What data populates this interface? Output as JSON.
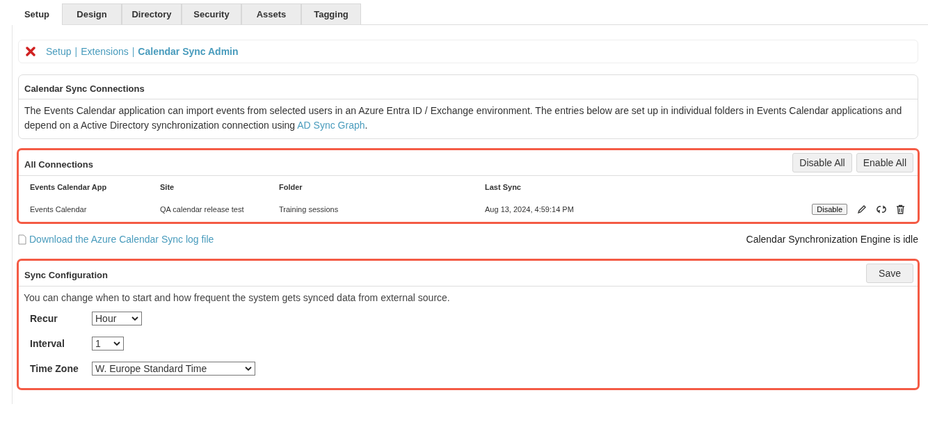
{
  "tabs": [
    {
      "label": "Setup",
      "selected": true
    },
    {
      "label": "Design",
      "selected": false
    },
    {
      "label": "Directory",
      "selected": false
    },
    {
      "label": "Security",
      "selected": false
    },
    {
      "label": "Assets",
      "selected": false
    },
    {
      "label": "Tagging",
      "selected": false
    }
  ],
  "breadcrumb": {
    "separator": "|",
    "items": [
      {
        "label": "Setup",
        "current": false
      },
      {
        "label": "Extensions",
        "current": false
      },
      {
        "label": "Calendar Sync Admin",
        "current": true
      }
    ]
  },
  "intro": {
    "title": "Calendar Sync Connections",
    "text_before": "The Events Calendar application can import events from selected users in an Azure Entra ID / Exchange environment. The entries below are set up in individual folders in Events Calendar applications and depend on a Active Directory synchronization connection using ",
    "link": "AD Sync Graph",
    "text_after": "."
  },
  "connections": {
    "title": "All Connections",
    "highlighted": true,
    "buttons": [
      "Disable All",
      "Enable All"
    ],
    "columns": [
      "Events Calendar App",
      "Site",
      "Folder",
      "Last Sync"
    ],
    "rows": [
      {
        "cells": [
          "Events Calendar",
          "QA calendar release test",
          "Training sessions",
          "Aug 13, 2024, 4:59:14 PM"
        ],
        "action": "Disable"
      }
    ]
  },
  "download_link": "Download the Azure Calendar Sync log file",
  "engine_status": "Calendar Synchronization Engine is idle",
  "sync_config": {
    "title": "Sync Configuration",
    "highlighted": true,
    "save": "Save",
    "description": "You can change when to start and how frequent the system gets synced data from external source.",
    "fields": [
      {
        "label": "Recur",
        "value": "Hour"
      },
      {
        "label": "Interval",
        "value": "1"
      },
      {
        "label": "Time Zone",
        "value": "W. Europe Standard Time"
      }
    ]
  }
}
